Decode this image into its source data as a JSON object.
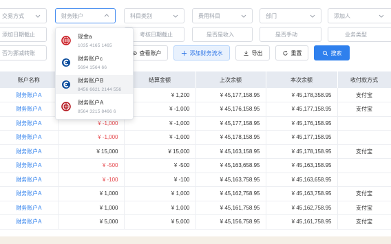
{
  "filters": {
    "row1": [
      {
        "name": "transaction-method-select",
        "placeholder": "交易方式",
        "dropdown": true
      },
      {
        "name": "finance-account-select",
        "placeholder": "财务账户",
        "dropdown": true
      },
      {
        "name": "subject-category-select",
        "placeholder": "科目类别",
        "dropdown": true
      },
      {
        "name": "expense-subject-select",
        "placeholder": "费用科目",
        "dropdown": true
      },
      {
        "name": "department-select",
        "placeholder": "部门",
        "dropdown": true
      },
      {
        "name": "added-by-select",
        "placeholder": "添加人",
        "dropdown": true
      }
    ],
    "row2": [
      {
        "name": "added-date-end",
        "placeholder": "添加日期截止"
      },
      {
        "name": "audit-date-end",
        "placeholder": "考核日期截止"
      },
      {
        "name": "is-income-select",
        "placeholder": "是否是收入"
      },
      {
        "name": "is-manual-select",
        "placeholder": "是否手动"
      },
      {
        "name": "business-type-select",
        "placeholder": "业务类型"
      }
    ],
    "row3_left": "否为挪减转账"
  },
  "toolbar": {
    "view_account": "查看账户",
    "add_flow": "添加财务流水",
    "export": "导出",
    "reset": "重置",
    "search": "搜索"
  },
  "dropdown": {
    "items": [
      {
        "name": "现金a",
        "number": "1035 4165 1465",
        "logo": "icbc-logo-icon",
        "color": "#c8161d"
      },
      {
        "name": "财务账户c",
        "number": "5694 1564 66",
        "logo": "ccb-logo-icon",
        "color": "#0b4c9c"
      },
      {
        "name": "财务账户B",
        "number": "8456 6621 2144 556",
        "logo": "ccb-logo-icon",
        "color": "#0b4c9c"
      },
      {
        "name": "财务账户A",
        "number": "8564 3215 8466 6",
        "logo": "boc-logo-icon",
        "color": "#b3141c"
      }
    ]
  },
  "table": {
    "headers": [
      "账户名称",
      "",
      "结算金额",
      "上次余额",
      "本次余额",
      "收付款方式"
    ],
    "rows": [
      {
        "account": "财务账户A",
        "amount": "",
        "settle": "¥ 1,200",
        "prev": "¥ 45,177,158.95",
        "curr": "¥ 45,178,358.95",
        "method": "支付宝",
        "neg": false
      },
      {
        "account": "财务账户A",
        "amount": "",
        "settle": "¥ -1,000",
        "prev": "¥ 45,176,158.95",
        "curr": "¥ 45,177,158.95",
        "method": "支付宝",
        "neg": false
      },
      {
        "account": "财务账户A",
        "amount": "¥ -1,000",
        "settle": "¥ -1,000",
        "prev": "¥ 45,177,158.95",
        "curr": "¥ 45,176,158.95",
        "method": "",
        "neg": true
      },
      {
        "account": "财务账户A",
        "amount": "¥ -1,000",
        "settle": "¥ -1,000",
        "prev": "¥ 45,178,158.95",
        "curr": "¥ 45,177,158.95",
        "method": "",
        "neg": true
      },
      {
        "account": "财务账户A",
        "amount": "¥ 15,000",
        "settle": "¥ 15,000",
        "prev": "¥ 45,163,158.95",
        "curr": "¥ 45,178,158.95",
        "method": "支付宝",
        "neg": false
      },
      {
        "account": "财务账户A",
        "amount": "¥ -500",
        "settle": "¥ -500",
        "prev": "¥ 45,163,658.95",
        "curr": "¥ 45,163,158.95",
        "method": "",
        "neg": true
      },
      {
        "account": "财务账户A",
        "amount": "¥ -100",
        "settle": "¥ -100",
        "prev": "¥ 45,163,758.95",
        "curr": "¥ 45,163,658.95",
        "method": "",
        "neg": true
      },
      {
        "account": "财务账户A",
        "amount": "¥ 1,000",
        "settle": "¥ 1,000",
        "prev": "¥ 45,162,758.95",
        "curr": "¥ 45,163,758.95",
        "method": "支付宝",
        "neg": false
      },
      {
        "account": "财务账户A",
        "amount": "¥ 1,000",
        "settle": "¥ 1,000",
        "prev": "¥ 45,161,758.95",
        "curr": "¥ 45,162,758.95",
        "method": "支付宝",
        "neg": false
      },
      {
        "account": "财务账户A",
        "amount": "¥ 5,000",
        "settle": "¥ 5,000",
        "prev": "¥ 45,156,758.95",
        "curr": "¥ 45,161,758.95",
        "method": "支付宝",
        "neg": false
      }
    ]
  },
  "colors": {
    "primary": "#2f80ed",
    "negative": "#e5484d",
    "header_bg": "#e6eaf1"
  }
}
